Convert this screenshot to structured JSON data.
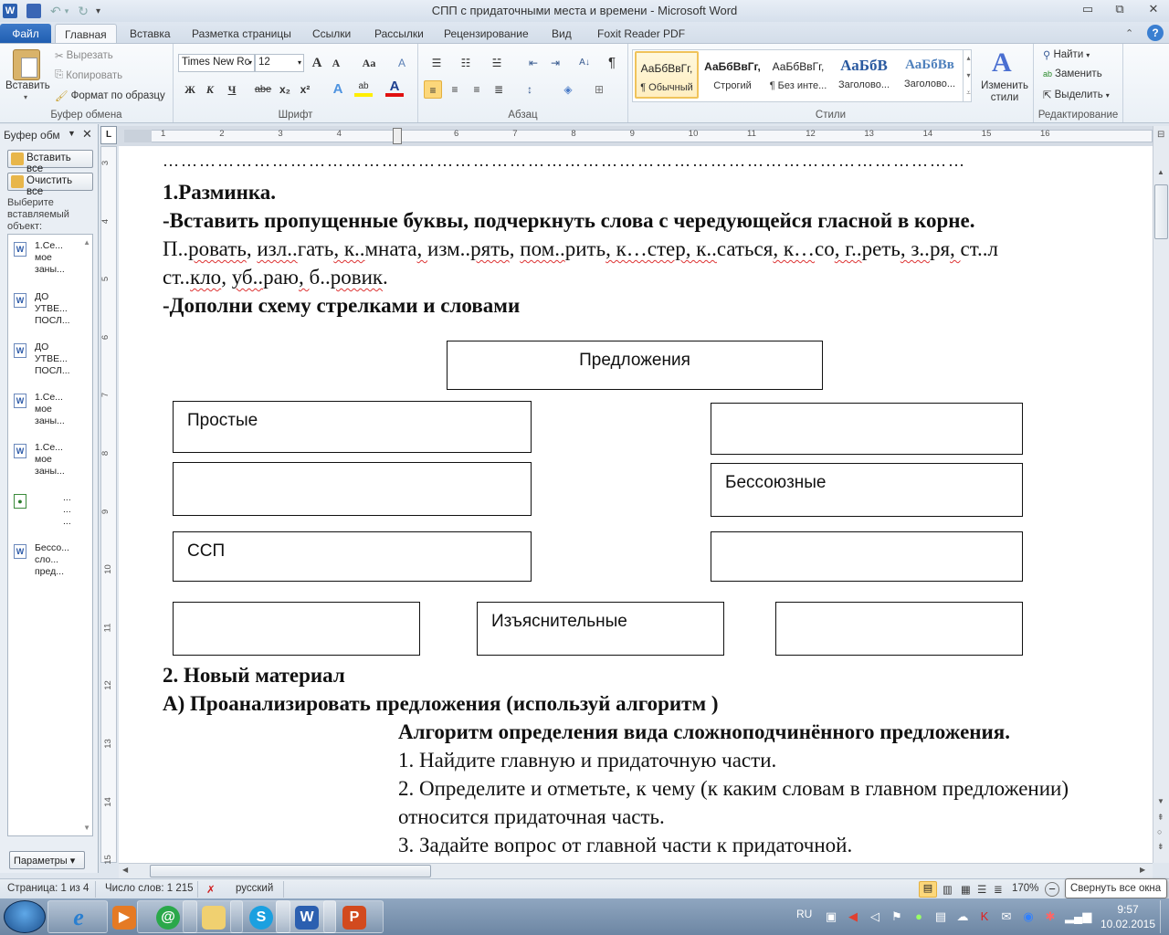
{
  "window": {
    "title": "СПП с придаточными места и времени  -  Microsoft Word",
    "controls": {
      "minimize": "▭",
      "restore": "⧉",
      "close": "✕"
    }
  },
  "qat": {
    "save": "save-icon",
    "undo": "undo-icon",
    "redo": "redo-icon",
    "customize": "▾"
  },
  "tabs": [
    {
      "label": "Файл"
    },
    {
      "label": "Главная"
    },
    {
      "label": "Вставка"
    },
    {
      "label": "Разметка страницы"
    },
    {
      "label": "Ссылки"
    },
    {
      "label": "Рассылки"
    },
    {
      "label": "Рецензирование"
    },
    {
      "label": "Вид"
    },
    {
      "label": "Foxit Reader PDF"
    }
  ],
  "ribbon": {
    "clipboard": {
      "label": "Буфер обмена",
      "paste": "Вставить",
      "cut": "Вырезать",
      "copy": "Копировать",
      "format_painter": "Формат по образцу"
    },
    "font": {
      "label": "Шрифт",
      "font_name": "Times New Rc",
      "font_size": "12",
      "bold": "Ж",
      "italic": "К",
      "underline": "Ч",
      "strike": "abe",
      "subscript": "x₂",
      "superscript": "x²",
      "grow": "A",
      "shrink": "A",
      "case": "Aa",
      "clear": "A"
    },
    "paragraph": {
      "label": "Абзац",
      "pilcrow": "¶"
    },
    "styles": {
      "label": "Стили",
      "items": [
        {
          "sample": "АаБбВвГг,",
          "name": "¶ Обычный",
          "selected": true
        },
        {
          "sample": "АаБбВвГг,",
          "name": "Строгий"
        },
        {
          "sample": "АаБбВвГг,",
          "name": "¶ Без инте..."
        },
        {
          "sample": "АаБбВ",
          "name": "Заголово..."
        },
        {
          "sample": "АаБбВв",
          "name": "Заголово..."
        }
      ],
      "change_styles": "Изменить стили"
    },
    "editing": {
      "label": "Редактирование",
      "find": "Найти",
      "replace": "Заменить",
      "select": "Выделить"
    }
  },
  "clipboard_pane": {
    "title": "Буфер обм",
    "paste_all": "Вставить все",
    "clear_all": "Очистить все",
    "hint": "Выберите вставляемый объект:",
    "items": [
      {
        "text": "1.Се... мое заны..."
      },
      {
        "text": "ДО УТВЕ... ПОСЛ..."
      },
      {
        "text": "ДО УТВЕ... ПОСЛ..."
      },
      {
        "text": "1.Се... мое заны..."
      },
      {
        "text": "1.Се... мое заны..."
      },
      {
        "text": "... ... ..."
      },
      {
        "text": "Бессо... сло... пред..."
      }
    ],
    "options": "Параметры ▾"
  },
  "ruler": {
    "h_numbers": [
      "1",
      "2",
      "3",
      "4",
      "5",
      "6",
      "7",
      "8",
      "9",
      "10",
      "11",
      "12",
      "13",
      "14",
      "15",
      "16"
    ],
    "v_numbers": [
      "3",
      "4",
      "5",
      "6",
      "7",
      "8",
      "9",
      "10",
      "11",
      "12",
      "13",
      "14",
      "15"
    ]
  },
  "document": {
    "dots": "……………………………………………………………………………………………………………………",
    "heading1": "1.Разминка.",
    "task1": "-Вставить  пропущенные буквы, подчеркнуть  слова с чередующейся гласной в корне.",
    "words_line1": [
      "П..",
      "ровать",
      ", ",
      "изл..",
      "гать",
      ", к..",
      "мната",
      ", ",
      "изм..",
      "рять",
      ", ",
      "пом..",
      "рить",
      ", к…стер, к..",
      "саться",
      ", к…",
      "со",
      ", г..",
      "реть",
      ", з..",
      "ря",
      ", ",
      "ст..л"
    ],
    "words_line2": [
      "ст..",
      "кло",
      ", ",
      "уб..",
      "раю",
      ", ",
      "б..",
      "ровик",
      "."
    ],
    "task2": "-Дополни схему стрелками и словами",
    "diagram": {
      "root": "Предложения",
      "left": [
        "Простые",
        "",
        "ССП"
      ],
      "right": [
        "",
        "Бессоюзные",
        ""
      ],
      "bottom": [
        "",
        "Изъяснительные",
        ""
      ]
    },
    "heading2": "2. Новый материал",
    "task3": "А) Проанализировать предложения (используй  алгоритм )",
    "algo_title": "Алгоритм  определения вида сложноподчинённого предложения.",
    "algo_steps": [
      "1. Найдите главную и придаточную части.",
      "2. Определите и отметьте, к чему (к каким словам в главном предложении)",
      "относится придаточная часть.",
      "3. Задайте вопрос от главной части к придаточной."
    ]
  },
  "status": {
    "page": "Страница: 1 из 4",
    "words": "Число слов: 1 215",
    "language": "русский",
    "zoom": "170%",
    "tooltip": "Свернуть все окна"
  },
  "taskbar": {
    "apps": [
      "internet-explorer",
      "media-player",
      "mail-agent",
      "explorer",
      "skype",
      "word",
      "powerpoint"
    ],
    "lang": "RU",
    "time": "9:57",
    "date": "10.02.2015"
  }
}
